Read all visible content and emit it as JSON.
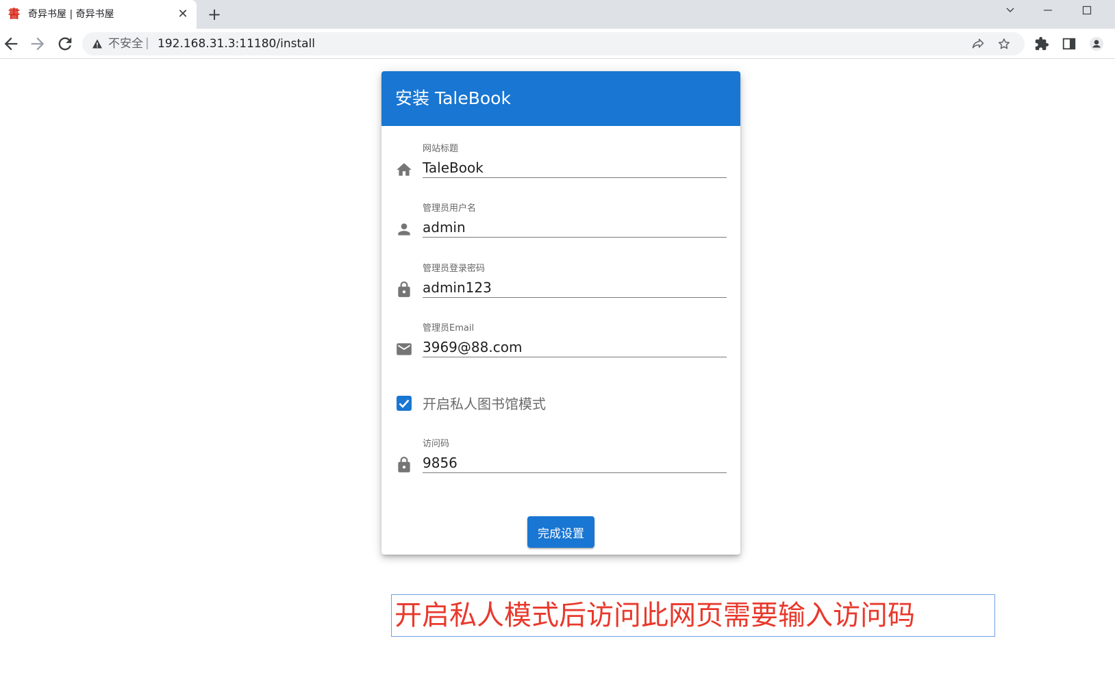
{
  "browser": {
    "tab": {
      "title": "奇异书屋 | 奇异书屋",
      "favicon": "書"
    },
    "new_tab_symbol": "+",
    "close_tab_symbol": "✕",
    "address_bar": {
      "security_label": "不安全",
      "separator": "|",
      "url": "192.168.31.3:11180/install"
    },
    "icons": [
      "back-icon",
      "forward-icon",
      "reload-icon",
      "warning-icon",
      "share-icon",
      "bookmark-star-icon",
      "extensions-icon",
      "side-panel-icon",
      "profile-icon"
    ]
  },
  "install": {
    "title": "安装 TaleBook",
    "fields": [
      {
        "label": "网站标题",
        "value": "TaleBook",
        "icon": "home-icon"
      },
      {
        "label": "管理员用户名",
        "value": "admin",
        "icon": "person-icon"
      },
      {
        "label": "管理员登录密码",
        "value": "admin123",
        "icon": "lock-icon"
      },
      {
        "label": "管理员Email",
        "value": "3969@88.com",
        "icon": "email-icon"
      }
    ],
    "private_mode": {
      "label": "开启私人图书馆模式",
      "checked": true
    },
    "access_code": {
      "label": "访问码",
      "value": "9856",
      "icon": "lock-icon"
    },
    "submit_label": "完成设置"
  },
  "annotation": {
    "text": "开启私人模式后访问此网页需要输入访问码",
    "color": "#e8392c"
  },
  "colors": {
    "primary": "#1976d2",
    "annotation_border": "#6f9ee8"
  }
}
